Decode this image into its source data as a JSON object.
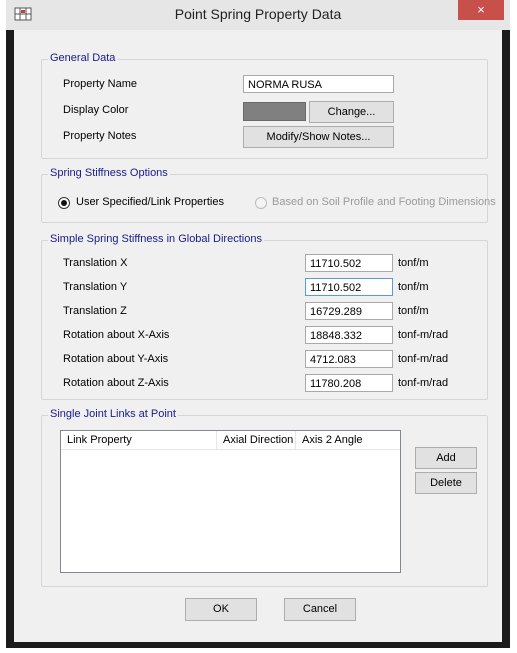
{
  "window": {
    "title": "Point Spring Property Data",
    "close_glyph": "×",
    "app_icon": "grid-icon"
  },
  "general_data": {
    "title": "General Data",
    "property_name_label": "Property Name",
    "property_name_value": "NORMA RUSA",
    "display_color_label": "Display Color",
    "display_color_value": "#808080",
    "change_button": "Change...",
    "property_notes_label": "Property Notes",
    "notes_button": "Modify/Show Notes..."
  },
  "spring_options": {
    "title": "Spring Stiffness Options",
    "option_user": "User Specified/Link Properties",
    "option_soil": "Based on Soil Profile and Footing Dimensions",
    "selected": "user"
  },
  "stiffness": {
    "title": "Simple Spring Stiffness in Global Directions",
    "rows": [
      {
        "label": "Translation  X",
        "value": "11710.502",
        "unit": "tonf/m"
      },
      {
        "label": "Translation  Y",
        "value": "11710.502",
        "unit": "tonf/m"
      },
      {
        "label": "Translation  Z",
        "value": "16729.289",
        "unit": "tonf/m"
      },
      {
        "label": "Rotation about  X-Axis",
        "value": "18848.332",
        "unit": "tonf-m/rad"
      },
      {
        "label": "Rotation about  Y-Axis",
        "value": "4712.083",
        "unit": "tonf-m/rad"
      },
      {
        "label": "Rotation about  Z-Axis",
        "value": "11780.208",
        "unit": "tonf-m/rad"
      }
    ]
  },
  "links": {
    "title": "Single Joint Links at Point",
    "columns": [
      "Link Property",
      "Axial Direction",
      "Axis 2 Angle"
    ],
    "add_button": "Add",
    "delete_button": "Delete"
  },
  "footer": {
    "ok_button": "OK",
    "cancel_button": "Cancel"
  }
}
